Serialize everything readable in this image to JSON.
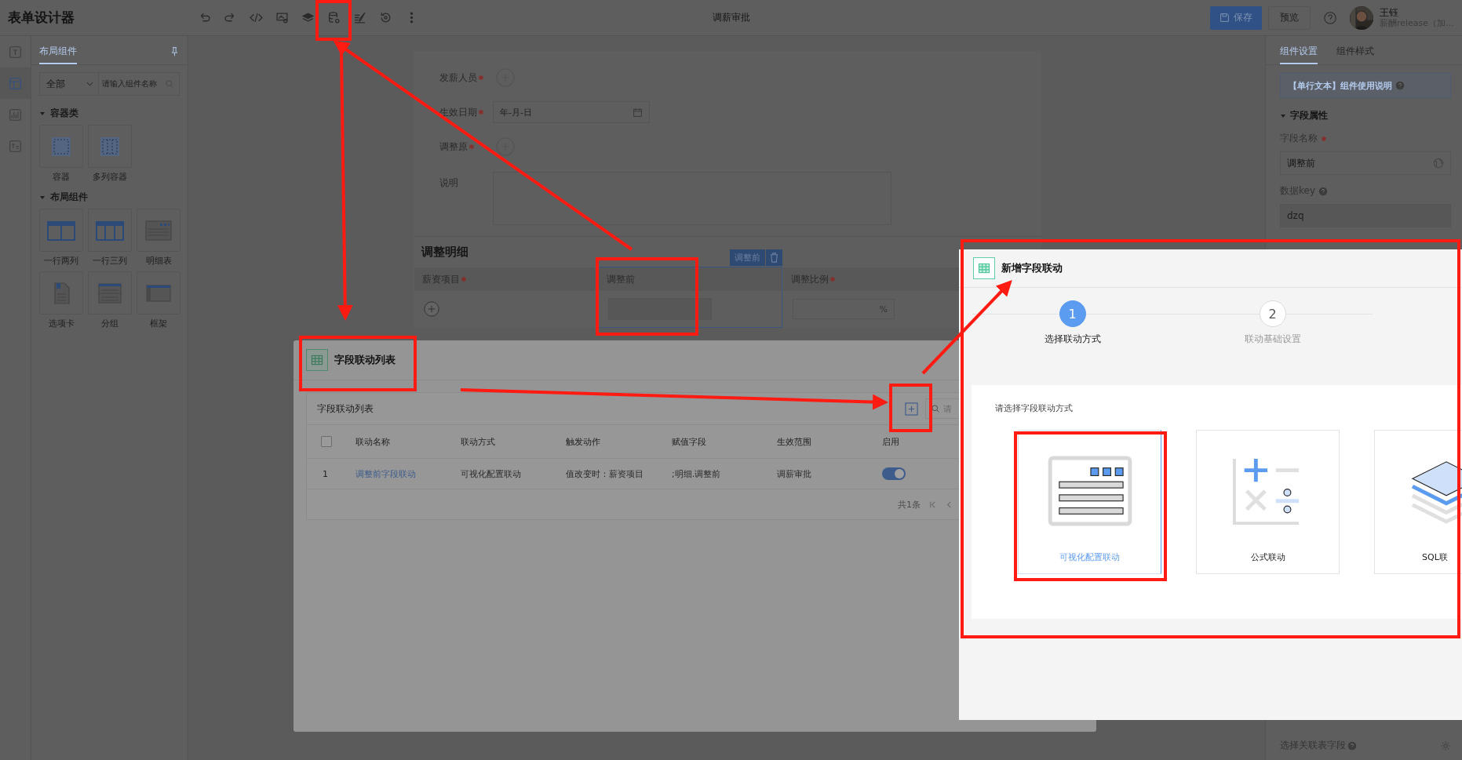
{
  "app": {
    "title": "表单设计器",
    "form_title": "调薪审批",
    "save": "保存",
    "preview": "预览"
  },
  "user": {
    "name": "王钰",
    "org": "薪酬release（加…"
  },
  "left_rail": [
    {
      "selected": false
    },
    {
      "selected": true
    },
    {
      "selected": false
    },
    {
      "selected": false
    }
  ],
  "component_panel": {
    "tab": "布局组件",
    "category": "全部",
    "search_placeholder": "请输入组件名称",
    "groups": [
      {
        "title": "容器类",
        "expanded": true,
        "items": [
          {
            "label": "容器",
            "kind": "container"
          },
          {
            "label": "多列容器",
            "kind": "multi"
          }
        ]
      },
      {
        "title": "布局组件",
        "expanded": true,
        "items": [
          {
            "label": "一行两列",
            "kind": "two"
          },
          {
            "label": "一行三列",
            "kind": "three"
          },
          {
            "label": "明细表",
            "kind": "detail"
          },
          {
            "label": "选项卡",
            "kind": "tabs"
          },
          {
            "label": "分组",
            "kind": "group"
          },
          {
            "label": "框架",
            "kind": "frame"
          }
        ]
      }
    ]
  },
  "form": {
    "fields": [
      {
        "label": "发薪人员",
        "required": true,
        "kind": "person"
      },
      {
        "label": "生效日期",
        "required": true,
        "kind": "date",
        "placeholder": "年-月-日"
      },
      {
        "label": "调整原",
        "required": true,
        "kind": "person"
      },
      {
        "label": "说明",
        "required": false,
        "kind": "textarea"
      }
    ],
    "detail": {
      "title": "调整明细",
      "columns": [
        {
          "label": "薪资项目",
          "required": true,
          "kind": "add",
          "selected": false
        },
        {
          "label": "调整前",
          "required": false,
          "kind": "input",
          "selected": true,
          "tag": "调整前"
        },
        {
          "label": "调整比例",
          "required": true,
          "kind": "percent",
          "unit": "%",
          "selected": false
        }
      ]
    }
  },
  "properties": {
    "tabs": [
      {
        "label": "组件设置",
        "selected": true
      },
      {
        "label": "组件样式",
        "selected": false
      }
    ],
    "help": "【单行文本】组件使用说明",
    "section": "字段属性",
    "fields": [
      {
        "label": "字段名称",
        "required": true,
        "help": false,
        "value": "调整前",
        "disabled": false
      },
      {
        "label": "数据key",
        "required": false,
        "help": true,
        "value": "dzq",
        "disabled": true
      }
    ],
    "bottom_field": "选择关联表字段"
  },
  "linkage_list_dialog": {
    "title": "字段联动列表",
    "list_title": "字段联动列表",
    "search_placeholder": "请",
    "select_all_checked": false,
    "columns": [
      "联动名称",
      "联动方式",
      "触发动作",
      "赋值字段",
      "生效范围",
      "启用"
    ],
    "rows": [
      {
        "index": "1",
        "name": "调整前字段联动",
        "mode": "可视化配置联动",
        "trigger": "值改变时：薪资项目",
        "target": ";明细.调整前",
        "scope": "调薪审批",
        "enabled": true
      }
    ],
    "total": "共1条"
  },
  "new_linkage_dialog": {
    "title": "新增字段联动",
    "steps": [
      {
        "number": "1",
        "label": "选择联动方式",
        "selected": true
      },
      {
        "number": "2",
        "label": "联动基础设置",
        "selected": false
      }
    ],
    "prompt": "请选择字段联动方式",
    "options": [
      {
        "label": "可视化配置联动",
        "kind": "visual",
        "selected": true
      },
      {
        "label": "公式联动",
        "kind": "formula",
        "selected": false
      },
      {
        "label": "SQL联",
        "kind": "sql",
        "selected": false
      }
    ]
  }
}
